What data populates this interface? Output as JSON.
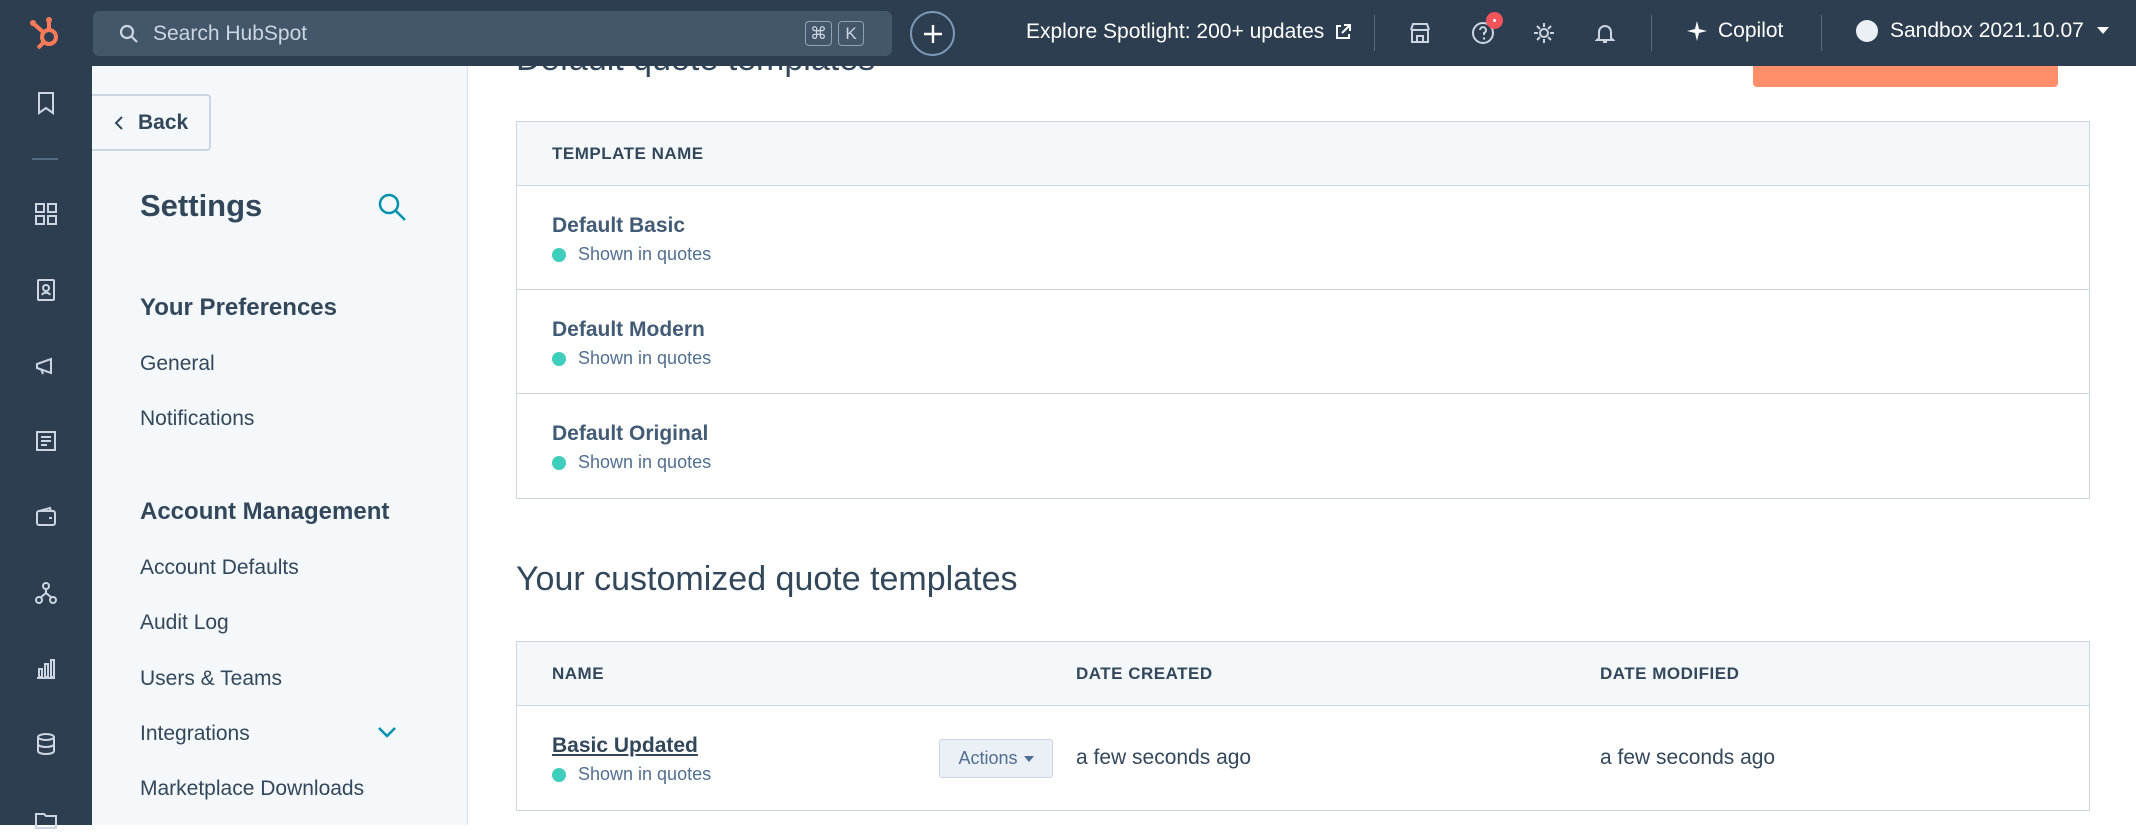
{
  "topnav": {
    "search_placeholder": "Search HubSpot",
    "kbd_cmd": "⌘",
    "kbd_k": "K",
    "spotlight": "Explore Spotlight: 200+ updates",
    "copilot": "Copilot",
    "account": "Sandbox 2021.10.07",
    "notification_badge": "•"
  },
  "sidebar": {
    "back": "Back",
    "title": "Settings",
    "sections": [
      {
        "title": "Your Preferences",
        "items": [
          "General",
          "Notifications"
        ]
      },
      {
        "title": "Account Management",
        "items": [
          "Account Defaults",
          "Audit Log",
          "Users & Teams",
          "Integrations",
          "Marketplace Downloads"
        ]
      }
    ]
  },
  "main": {
    "default_title": "Default quote templates",
    "default_table": {
      "header": "TEMPLATE NAME",
      "rows": [
        {
          "name": "Default Basic",
          "status": "Shown in quotes"
        },
        {
          "name": "Default Modern",
          "status": "Shown in quotes"
        },
        {
          "name": "Default Original",
          "status": "Shown in quotes"
        }
      ]
    },
    "custom_title": "Your customized quote templates",
    "custom_table": {
      "headers": [
        "NAME",
        "DATE CREATED",
        "DATE MODIFIED"
      ],
      "rows": [
        {
          "name": "Basic Updated",
          "status": "Shown in quotes",
          "actions": "Actions",
          "created": "a few seconds ago",
          "modified": "a few seconds ago"
        }
      ]
    }
  },
  "colors": {
    "nav_bg": "#2d3e50",
    "brand_orange": "#ff7a59",
    "status_green": "#00bda5",
    "text": "#33475b"
  }
}
